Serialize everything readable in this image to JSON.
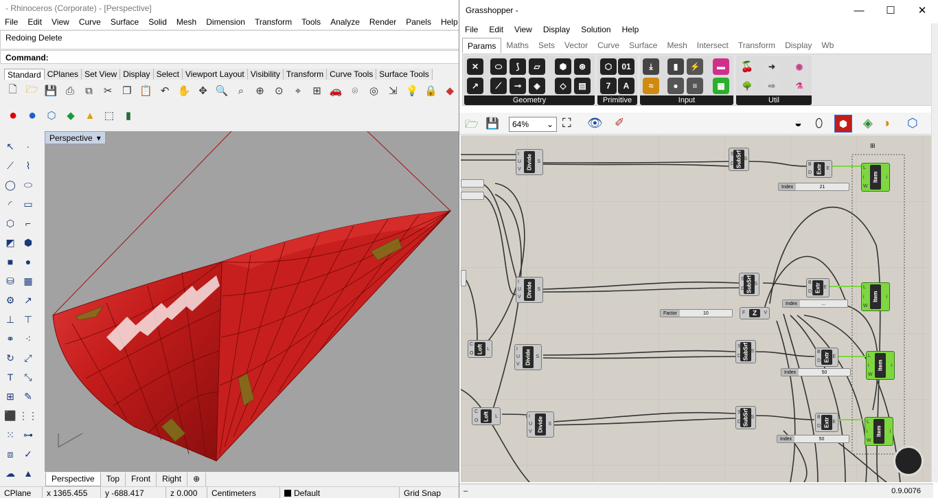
{
  "rhino": {
    "title": "- Rhinoceros (Corporate) - [Perspective]",
    "menu": [
      "File",
      "Edit",
      "View",
      "Curve",
      "Surface",
      "Solid",
      "Mesh",
      "Dimension",
      "Transform",
      "Tools",
      "Analyze",
      "Render",
      "Panels",
      "Help"
    ],
    "history": "Redoing Delete",
    "command_label": "Command:",
    "toolbar_tabs": [
      "Standard",
      "CPlanes",
      "Set View",
      "Display",
      "Select",
      "Viewport Layout",
      "Visibility",
      "Transform",
      "Curve Tools",
      "Surface Tools"
    ],
    "viewport_label": "Perspective",
    "viewport_tabs": [
      "Perspective",
      "Top",
      "Front",
      "Right"
    ],
    "status": {
      "cplane": "CPlane",
      "x": "x 1365.455",
      "y": "y -688.417",
      "z": "z 0.000",
      "units": "Centimeters",
      "layer": "Default",
      "grid_snap": "Grid Snap"
    },
    "colors": {
      "surface": "#d0211f",
      "viewport_bg": "#a2a2a2",
      "layer_swatch": "#000000"
    }
  },
  "grasshopper": {
    "title": "Grasshopper -",
    "menu": [
      "File",
      "Edit",
      "View",
      "Display",
      "Solution",
      "Help"
    ],
    "tabs": [
      "Params",
      "Maths",
      "Sets",
      "Vector",
      "Curve",
      "Surface",
      "Mesh",
      "Intersect",
      "Transform",
      "Display",
      "Wb"
    ],
    "active_tab": "Params",
    "ribbon_groups": [
      "Geometry",
      "Primitive",
      "Input",
      "Util"
    ],
    "primitive_icons": [
      "01",
      "7",
      "A"
    ],
    "zoom": "64%",
    "version": "0.9.0076",
    "components": {
      "divide": "Divide",
      "subsrf": "SubSrf",
      "extr": "Extr",
      "item": "Item",
      "loft": "Loft",
      "z": "Z"
    },
    "ports": {
      "divide_in": [
        "I",
        "U",
        "V"
      ],
      "divide_out": "S",
      "subsrf_in": [
        "S",
        "D"
      ],
      "subsrf_out": "S",
      "extr_in": [
        "B",
        "D"
      ],
      "extr_out": "E",
      "item_in": [
        "L",
        "i",
        "W"
      ],
      "item_out": "i",
      "loft_in": [
        "C",
        "O"
      ],
      "loft_out": "L",
      "z_in": "F",
      "z_out": "V"
    },
    "sliders": [
      {
        "name": "Index",
        "value": "21"
      },
      {
        "name": "Index",
        "value": "..."
      },
      {
        "name": "Factor",
        "value": "10"
      },
      {
        "name": "Index",
        "value": "50"
      },
      {
        "name": "Index",
        "value": "50"
      }
    ],
    "colors": {
      "canvas": "#d4d0c8",
      "item_component": "#7ed640",
      "wire": "#333333",
      "active_wire": "#7ed640"
    }
  }
}
